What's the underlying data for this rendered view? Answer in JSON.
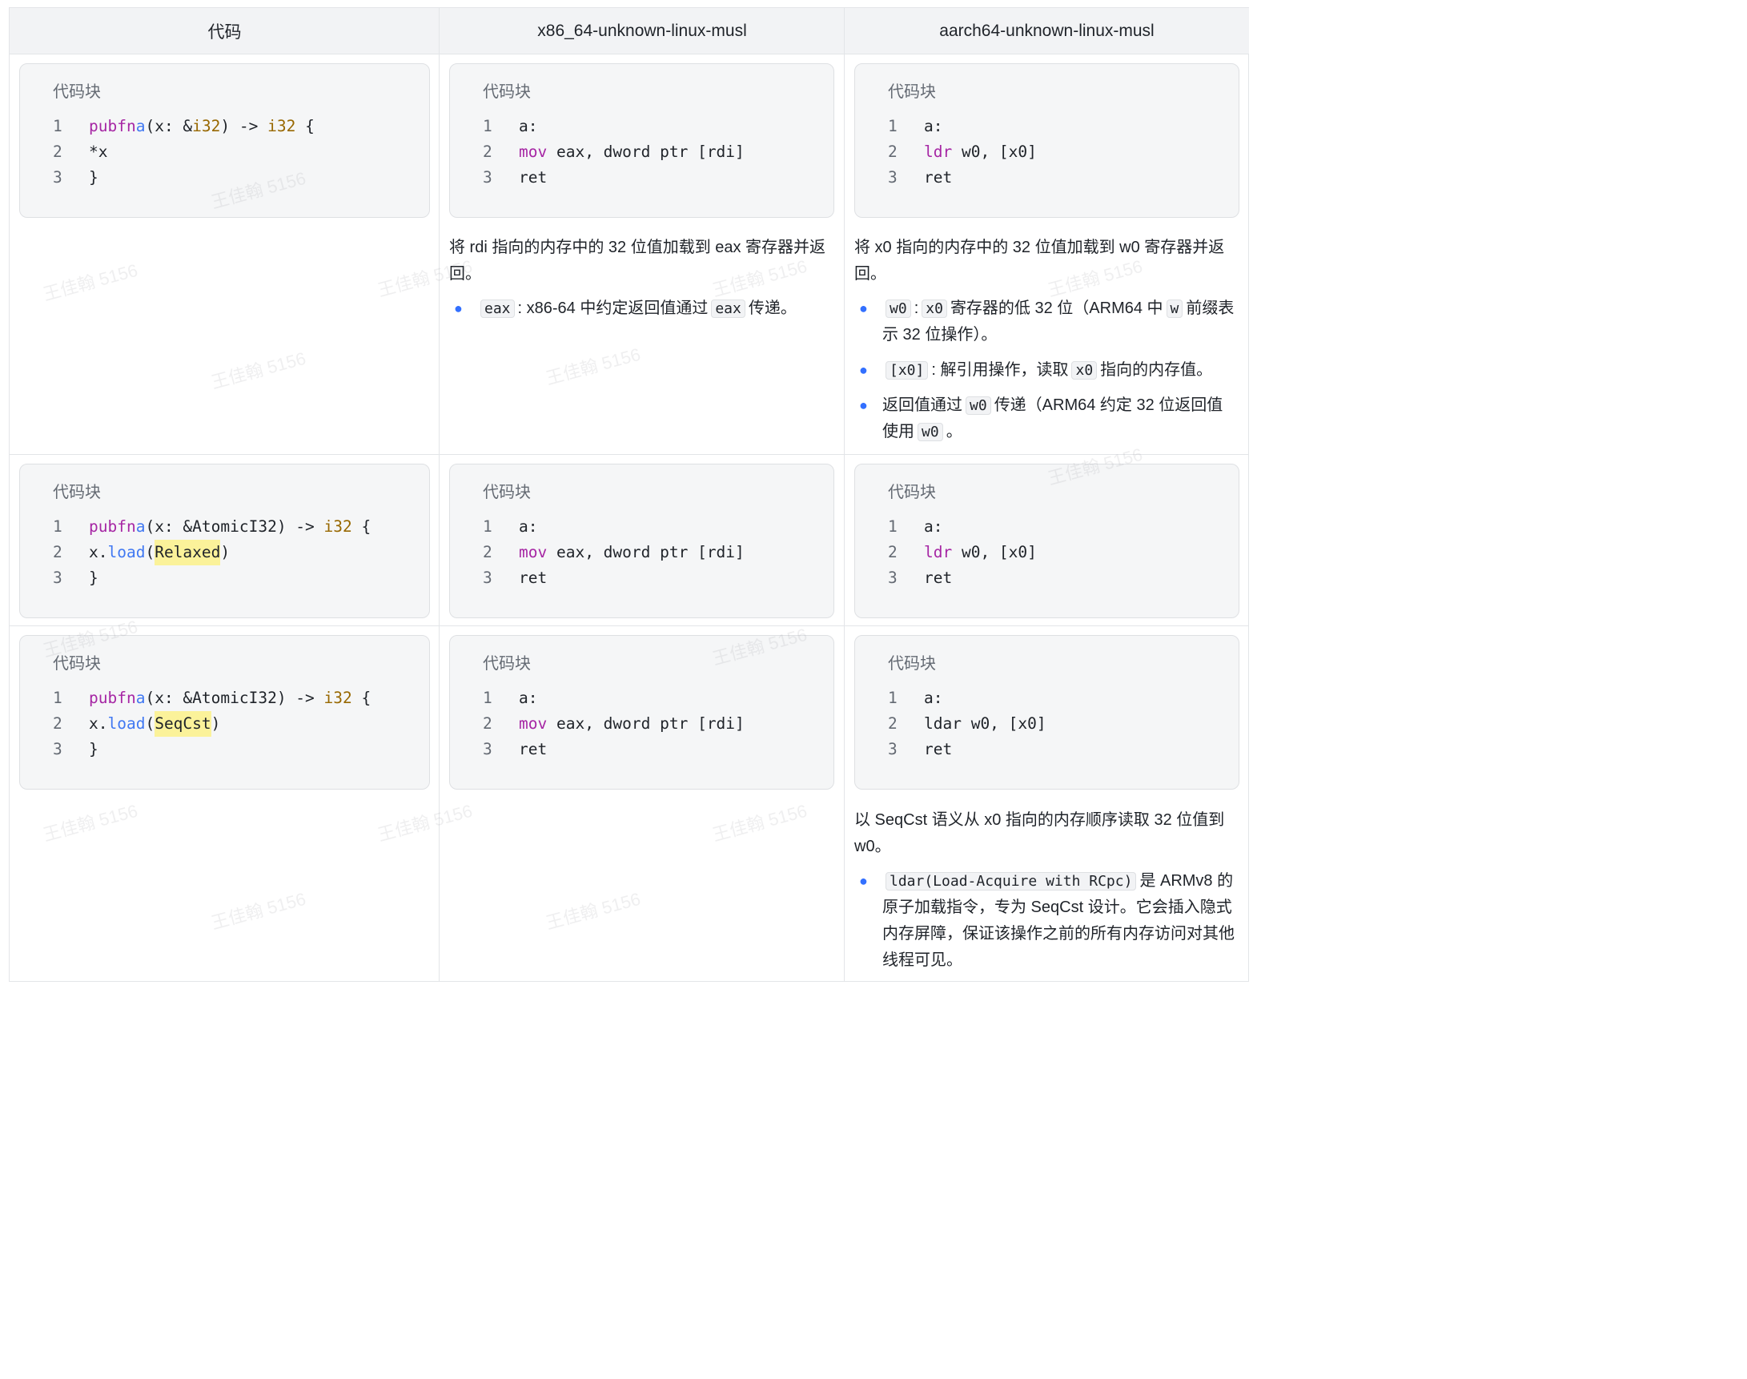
{
  "header": {
    "col1": "代码",
    "col2": "x86_64-unknown-linux-musl",
    "col3": "aarch64-unknown-linux-musl"
  },
  "block_title": "代码块",
  "rows": [
    {
      "rust": {
        "line2": "*x"
      },
      "x86": {
        "label": "a:",
        "mov": "mov",
        "mov_args": " eax, dword ptr [rdi]",
        "ret": "ret"
      },
      "arm": {
        "label": "a:",
        "op": "ldr",
        "op_args": " w0, [x0]",
        "ret": "ret"
      },
      "x86_desc": {
        "text": "将 rdi 指向的内存中的 32 位值加载到 eax 寄存器并返回。",
        "b1_code1": "eax",
        "b1_text1": ": x86-64 中约定返回值通过",
        "b1_code2": "eax",
        "b1_text2": "传递。"
      },
      "arm_desc": {
        "text": "将 x0 指向的内存中的 32 位值加载到 w0 寄存器并返回。",
        "b1_code1": "w0",
        "b1_sep": ":",
        "b1_code2": "x0",
        "b1_text1": "寄存器的低 32 位（ARM64 中",
        "b1_code3": "w",
        "b1_text2": "前缀表示 32 位操作）。",
        "b2_code1": "[x0]",
        "b2_text1": ": 解引用操作，读取",
        "b2_code2": "x0",
        "b2_text2": "指向的内存值。",
        "b3_text1": "返回值通过",
        "b3_code1": "w0",
        "b3_text2": "传递（ARM64 约定 32 位返回值使用",
        "b3_code2": "w0",
        "b3_text3": "。"
      }
    },
    {
      "rust": {
        "ordering": "Relaxed"
      },
      "x86": {
        "label": "a:",
        "mov": "mov",
        "mov_args": " eax, dword ptr [rdi]",
        "ret": "ret"
      },
      "arm": {
        "label": "a:",
        "op": "ldr",
        "op_args": " w0, [x0]",
        "ret": "ret"
      }
    },
    {
      "rust": {
        "ordering": "SeqCst"
      },
      "x86": {
        "label": "a:",
        "mov": "mov",
        "mov_args": " eax, dword ptr [rdi]",
        "ret": "ret"
      },
      "arm": {
        "label": "a:",
        "op": "ldar w0, [x0]",
        "ret": "ret"
      },
      "arm_desc": {
        "text": "以 SeqCst 语义从 x0 指向的内存顺序读取 32 位值到 w0。",
        "b1_code1": "ldar(Load-Acquire with RCpc)",
        "b1_text1": "是 ARMv8 的原子加载指令，专为 SeqCst 设计。它会插入隐式内存屏障，保证该操作之前的所有内存访问对其他线程可见。"
      }
    }
  ],
  "rust_common": {
    "pub": "pub",
    "fn": "fn",
    "name": "a",
    "sig_i32": "(x: &",
    "i32": "i32",
    "arrow": ") -> ",
    "ret_ty": "i32",
    "brace": " {",
    "sig_atomic": "(x: &AtomicI32) -> ",
    "load_prefix": "x.",
    "load": "load",
    "close": "}"
  },
  "line_numbers": [
    "1",
    "2",
    "3"
  ],
  "watermark": "王佳翰 5156"
}
